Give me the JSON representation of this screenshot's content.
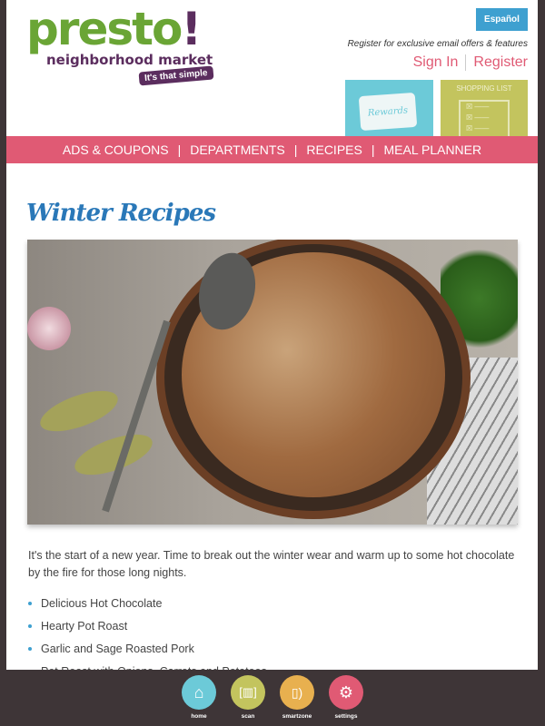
{
  "header": {
    "logo": {
      "main": "presto",
      "bang": "!",
      "sub": "neighborhood market",
      "tagline": "It's that simple"
    },
    "language_button": "Español",
    "promo_text": "Register for exclusive email offers & features",
    "sign_in": "Sign In",
    "register": "Register",
    "rewards_card": "Rewards",
    "shopping_list": "SHOPPING LIST"
  },
  "nav": {
    "items": [
      "ADS & COUPONS",
      "DEPARTMENTS",
      "RECIPES",
      "MEAL PLANNER"
    ],
    "separator": "|"
  },
  "main": {
    "title": "Winter Recipes",
    "intro": "It's the start of a new year. Time to break out the winter wear and warm up to some hot chocolate by the fire for those long nights.",
    "recipes": [
      "Delicious Hot Chocolate",
      "Hearty Pot Roast",
      "Garlic and Sage Roasted Pork",
      "Pot Roast with Onions, Carrots and Potatoes"
    ]
  },
  "dock": [
    {
      "label": "home",
      "icon": "home-icon",
      "color": "#6ccad8"
    },
    {
      "label": "scan",
      "icon": "barcode-scan-icon",
      "color": "#c3c45e"
    },
    {
      "label": "smartzone",
      "icon": "phone-signal-icon",
      "color": "#e8b04f"
    },
    {
      "label": "settings",
      "icon": "gear-icon",
      "color": "#e05a74"
    }
  ],
  "colors": {
    "nav": "#e05a74",
    "accent_blue": "#3ea0d0",
    "logo_green": "#6aa535",
    "logo_purple": "#5b2d5e",
    "frame": "#3e3537"
  }
}
